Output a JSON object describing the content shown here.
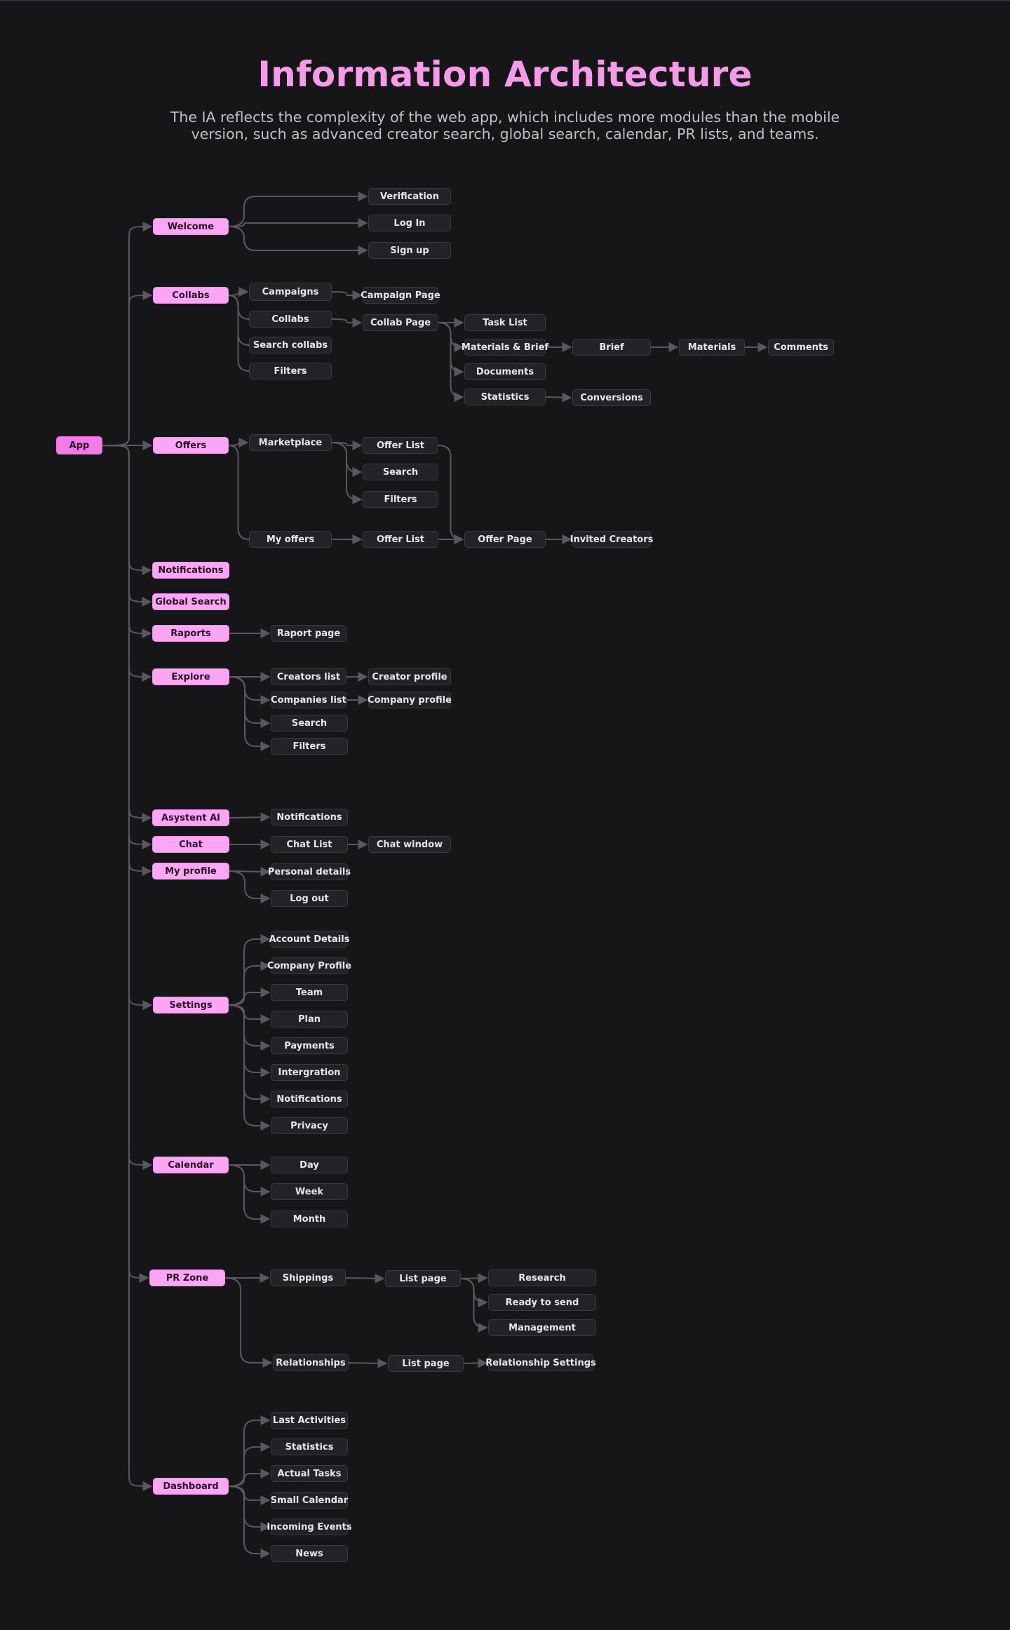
{
  "title": "Information Architecture",
  "subtitle": "The IA reflects the complexity of the web app, which includes more modules than the mobile version, such as advanced creator search, global search, calendar, PR lists, and teams.",
  "colors": {
    "background": "#161518",
    "accent": "#fba6f4",
    "node": "#232226",
    "line": "#5a585e"
  },
  "nodes": {
    "app": "App",
    "welcome": "Welcome",
    "verification": "Verification",
    "log_in": "Log In",
    "sign_up": "Sign up",
    "collabs": "Collabs",
    "campaigns": "Campaigns",
    "campaign_page": "Campaign Page",
    "collabs_sub": "Collabs",
    "collab_page": "Collab Page",
    "search_collabs": "Search collabs",
    "filters_collabs": "Filters",
    "task_list": "Task List",
    "materials_brief": "Materials & Brief",
    "brief": "Brief",
    "materials": "Materials",
    "comments": "Comments",
    "documents": "Documents",
    "statistics_collab": "Statistics",
    "conversions": "Conversions",
    "offers": "Offers",
    "marketplace": "Marketplace",
    "offer_list_1": "Offer List",
    "search_offers": "Search",
    "filters_offers": "Filters",
    "my_offers": "My offers",
    "offer_list_2": "Offer List",
    "offer_page": "Offer  Page",
    "invited_creators": "Invited Creators",
    "notifications": "Notifications",
    "global_search": "Global Search",
    "raports": "Raports",
    "raport_page": "Raport page",
    "explore": "Explore",
    "creators_list": "Creators list",
    "creator_profile": "Creator profile",
    "companies_list": "Companies list",
    "company_profile": "Company profile",
    "search_explore": "Search",
    "filters_explore": "Filters",
    "asystent_ai": "Asystent AI",
    "notifications_ai": "Notifications",
    "chat": "Chat",
    "chat_list": "Chat List",
    "chat_window": "Chat window",
    "my_profile": "My profile",
    "personal_details": "Personal details",
    "log_out": "Log out",
    "settings": "Settings",
    "account_details": "Account Details",
    "company_profile_settings": "Company Profile",
    "team": "Team",
    "plan": "Plan",
    "payments": "Payments",
    "intergration": "Intergration",
    "notifications_settings": "Notifications",
    "privacy": "Privacy",
    "calendar": "Calendar",
    "day": "Day",
    "week": "Week",
    "month": "Month",
    "pr_zone": "PR Zone",
    "shippings": "Shippings",
    "list_page_1": "List page",
    "research": "Research",
    "ready_to_send": "Ready to send",
    "management": "Management",
    "relationships": "Relationships",
    "list_page_2": "List page",
    "relationship_settings": "Relationship Settings",
    "dashboard": "Dashboard",
    "last_activities": "Last Activities",
    "statistics_dash": "Statistics",
    "actual_tasks": "Actual Tasks",
    "small_calendar": "Small Calendar",
    "incoming_events": "Incoming Events",
    "news": "News"
  },
  "links": [
    [
      "app",
      "welcome"
    ],
    [
      "app",
      "collabs"
    ],
    [
      "app",
      "offers"
    ],
    [
      "app",
      "notifications"
    ],
    [
      "app",
      "global_search"
    ],
    [
      "app",
      "raports"
    ],
    [
      "app",
      "explore"
    ],
    [
      "app",
      "asystent_ai"
    ],
    [
      "app",
      "chat"
    ],
    [
      "app",
      "my_profile"
    ],
    [
      "app",
      "settings"
    ],
    [
      "app",
      "calendar"
    ],
    [
      "app",
      "pr_zone"
    ],
    [
      "app",
      "dashboard"
    ],
    [
      "welcome",
      "verification"
    ],
    [
      "welcome",
      "log_in"
    ],
    [
      "welcome",
      "sign_up"
    ],
    [
      "collabs",
      "campaigns"
    ],
    [
      "collabs",
      "collabs_sub"
    ],
    [
      "collabs",
      "search_collabs"
    ],
    [
      "collabs",
      "filters_collabs"
    ],
    [
      "campaigns",
      "campaign_page"
    ],
    [
      "collabs_sub",
      "collab_page"
    ],
    [
      "collab_page",
      "task_list"
    ],
    [
      "collab_page",
      "materials_brief"
    ],
    [
      "collab_page",
      "documents"
    ],
    [
      "collab_page",
      "statistics_collab"
    ],
    [
      "materials_brief",
      "brief"
    ],
    [
      "brief",
      "materials"
    ],
    [
      "materials",
      "comments"
    ],
    [
      "statistics_collab",
      "conversions"
    ],
    [
      "offers",
      "marketplace"
    ],
    [
      "offers",
      "my_offers"
    ],
    [
      "marketplace",
      "offer_list_1"
    ],
    [
      "marketplace",
      "search_offers"
    ],
    [
      "marketplace",
      "filters_offers"
    ],
    [
      "my_offers",
      "offer_list_2"
    ],
    [
      "offer_list_1",
      "offer_page"
    ],
    [
      "offer_list_2",
      "offer_page"
    ],
    [
      "offer_page",
      "invited_creators"
    ],
    [
      "raports",
      "raport_page"
    ],
    [
      "explore",
      "creators_list"
    ],
    [
      "explore",
      "companies_list"
    ],
    [
      "explore",
      "search_explore"
    ],
    [
      "explore",
      "filters_explore"
    ],
    [
      "creators_list",
      "creator_profile"
    ],
    [
      "companies_list",
      "company_profile"
    ],
    [
      "asystent_ai",
      "notifications_ai"
    ],
    [
      "chat",
      "chat_list"
    ],
    [
      "chat_list",
      "chat_window"
    ],
    [
      "my_profile",
      "personal_details"
    ],
    [
      "my_profile",
      "log_out"
    ],
    [
      "settings",
      "account_details"
    ],
    [
      "settings",
      "company_profile_settings"
    ],
    [
      "settings",
      "team"
    ],
    [
      "settings",
      "plan"
    ],
    [
      "settings",
      "payments"
    ],
    [
      "settings",
      "intergration"
    ],
    [
      "settings",
      "notifications_settings"
    ],
    [
      "settings",
      "privacy"
    ],
    [
      "calendar",
      "day"
    ],
    [
      "calendar",
      "week"
    ],
    [
      "calendar",
      "month"
    ],
    [
      "pr_zone",
      "shippings"
    ],
    [
      "pr_zone",
      "relationships"
    ],
    [
      "shippings",
      "list_page_1"
    ],
    [
      "list_page_1",
      "research"
    ],
    [
      "list_page_1",
      "ready_to_send"
    ],
    [
      "list_page_1",
      "management"
    ],
    [
      "relationships",
      "list_page_2"
    ],
    [
      "list_page_2",
      "relationship_settings"
    ],
    [
      "dashboard",
      "last_activities"
    ],
    [
      "dashboard",
      "statistics_dash"
    ],
    [
      "dashboard",
      "actual_tasks"
    ],
    [
      "dashboard",
      "small_calendar"
    ],
    [
      "dashboard",
      "incoming_events"
    ],
    [
      "dashboard",
      "news"
    ]
  ]
}
